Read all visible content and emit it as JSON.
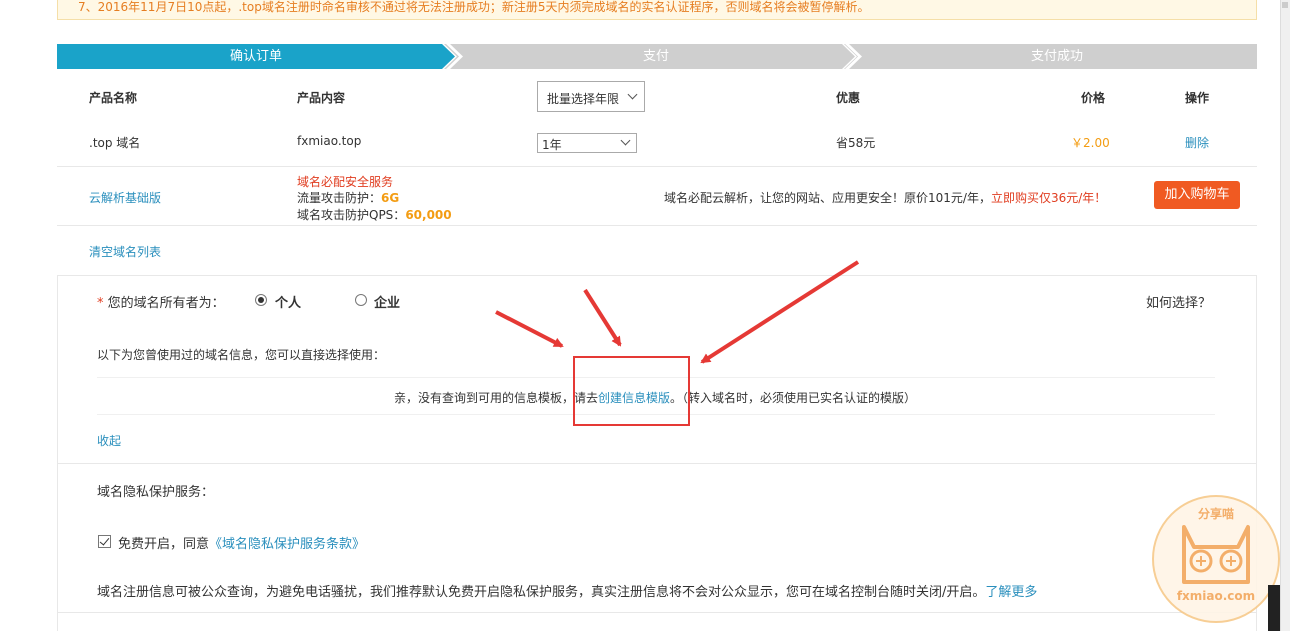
{
  "notice": {
    "text": "7、2016年11月7日10点起，.top域名注册时命名审核不通过将无法注册成功；新注册5天内须完成域名的实名认证程序，否则域名将会被暂停解析。"
  },
  "steps": [
    {
      "label": "确认订单",
      "active": true
    },
    {
      "label": "支付",
      "active": false
    },
    {
      "label": "支付成功",
      "active": false
    }
  ],
  "table": {
    "headers": {
      "name": "产品名称",
      "content": "产品内容",
      "batch_select": "批量选择年限",
      "discount": "优惠",
      "price": "价格",
      "action": "操作"
    },
    "row": {
      "name": ".top 域名",
      "content": "fxmiao.top",
      "years": "1年",
      "discount": "省58元",
      "price": "￥2.00",
      "action": "删除"
    }
  },
  "dns_promo": {
    "name": "云解析基础版",
    "title": "域名必配安全服务",
    "line1_label": "流量攻击防护：",
    "line1_value": "6G",
    "line2_label": "域名攻击防护QPS：",
    "line2_value": "60,000",
    "desc": "域名必配云解析，让您的网站、应用更安全！原价101元/年，",
    "desc_highlight": "立即购买仅36元/年！",
    "button": "加入购物车"
  },
  "clear_list": "清空域名列表",
  "owner": {
    "required_mark": "*",
    "label": "您的域名所有者为：",
    "options": [
      "个人",
      "企业"
    ],
    "selected": "个人",
    "help": "如何选择？",
    "history_label": "以下为您曾使用过的域名信息，您可以直接选择使用：",
    "empty_prefix": "亲，没有查询到可用的信息模板，请去",
    "empty_link": "创建信息模版",
    "empty_suffix": "。（转入域名时，必须使用已实名认证的模版）",
    "collapse": "收起"
  },
  "privacy": {
    "title": "域名隐私保护服务：",
    "checkbox_label": "免费开启，同意",
    "terms_link": "《域名隐私保护服务条款》",
    "desc": "域名注册信息可被公众查询，为避免电话骚扰，我们推荐默认免费开启隐私保护服务，真实注册信息将不会对公众显示，您可在域名控制台随时关闭/开启。",
    "learn_more": "了解更多"
  },
  "watermark": {
    "text_top": "分享喵",
    "text_bottom": "fxmiao.com"
  },
  "colors": {
    "accent": "#1aa3c9",
    "step_inactive": "#cfcfcf",
    "link": "#2a8fbd",
    "price": "#f39c12",
    "promo_red": "#e03c1f",
    "button": "#f05a22",
    "annotation": "#e53935"
  }
}
